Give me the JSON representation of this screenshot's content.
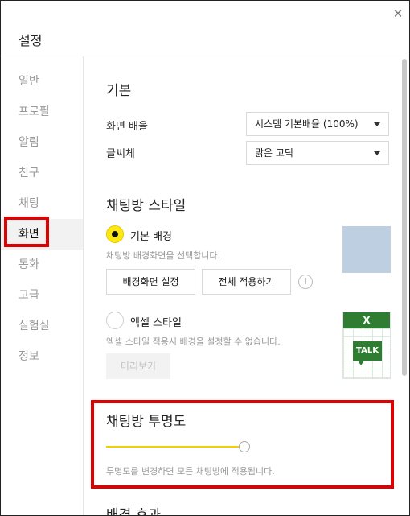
{
  "window": {
    "title": "설정",
    "close_glyph": "✕"
  },
  "sidebar": {
    "items": [
      {
        "label": "일반"
      },
      {
        "label": "프로필"
      },
      {
        "label": "알림"
      },
      {
        "label": "친구"
      },
      {
        "label": "채팅"
      },
      {
        "label": "화면",
        "active": true
      },
      {
        "label": "통화"
      },
      {
        "label": "고급"
      },
      {
        "label": "실험실"
      },
      {
        "label": "정보"
      }
    ]
  },
  "main": {
    "basic": {
      "heading": "기본",
      "zoom_label": "화면 배율",
      "zoom_value": "시스템 기본배율 (100%)",
      "font_label": "글씨체",
      "font_value": "맑은 고딕"
    },
    "chatroom_style": {
      "heading": "채팅방 스타일",
      "default_bg": {
        "label": "기본 배경",
        "desc": "채팅방 배경화면을 선택합니다.",
        "selected": true
      },
      "buttons": {
        "set_bg": "배경화면 설정",
        "apply_all": "전체 적용하기",
        "info_glyph": "i"
      },
      "excel": {
        "label": "엑셀 스타일",
        "desc": "엑셀 스타일 적용시 배경을 설정할 수 없습니다.",
        "selected": false,
        "preview_button": "미리보기",
        "thumb_header": "X",
        "thumb_badge": "TALK"
      }
    },
    "transparency": {
      "heading": "채팅방 투명도",
      "desc": "투명도를 변경하면 모든 채팅방에 적용됩니다.",
      "value_percent": 100
    },
    "next_heading": "배경 효과"
  },
  "colors": {
    "accent_yellow": "#ffe812",
    "highlight_red": "#e00000",
    "excel_green": "#2e7d32"
  }
}
